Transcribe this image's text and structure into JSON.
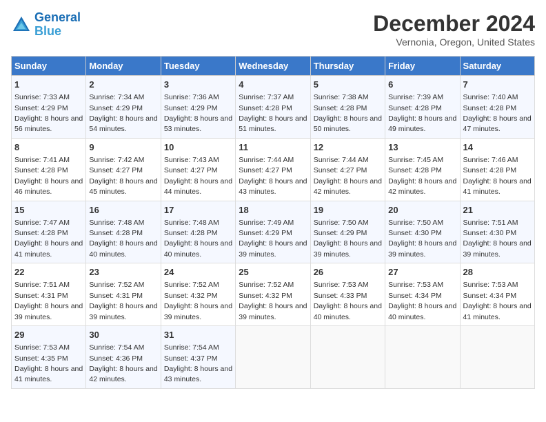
{
  "header": {
    "logo_line1": "General",
    "logo_line2": "Blue",
    "title": "December 2024",
    "subtitle": "Vernonia, Oregon, United States"
  },
  "calendar": {
    "days_of_week": [
      "Sunday",
      "Monday",
      "Tuesday",
      "Wednesday",
      "Thursday",
      "Friday",
      "Saturday"
    ],
    "weeks": [
      [
        {
          "day": "1",
          "sunrise": "7:33 AM",
          "sunset": "4:29 PM",
          "daylight": "8 hours and 56 minutes."
        },
        {
          "day": "2",
          "sunrise": "7:34 AM",
          "sunset": "4:29 PM",
          "daylight": "8 hours and 54 minutes."
        },
        {
          "day": "3",
          "sunrise": "7:36 AM",
          "sunset": "4:29 PM",
          "daylight": "8 hours and 53 minutes."
        },
        {
          "day": "4",
          "sunrise": "7:37 AM",
          "sunset": "4:28 PM",
          "daylight": "8 hours and 51 minutes."
        },
        {
          "day": "5",
          "sunrise": "7:38 AM",
          "sunset": "4:28 PM",
          "daylight": "8 hours and 50 minutes."
        },
        {
          "day": "6",
          "sunrise": "7:39 AM",
          "sunset": "4:28 PM",
          "daylight": "8 hours and 49 minutes."
        },
        {
          "day": "7",
          "sunrise": "7:40 AM",
          "sunset": "4:28 PM",
          "daylight": "8 hours and 47 minutes."
        }
      ],
      [
        {
          "day": "8",
          "sunrise": "7:41 AM",
          "sunset": "4:28 PM",
          "daylight": "8 hours and 46 minutes."
        },
        {
          "day": "9",
          "sunrise": "7:42 AM",
          "sunset": "4:27 PM",
          "daylight": "8 hours and 45 minutes."
        },
        {
          "day": "10",
          "sunrise": "7:43 AM",
          "sunset": "4:27 PM",
          "daylight": "8 hours and 44 minutes."
        },
        {
          "day": "11",
          "sunrise": "7:44 AM",
          "sunset": "4:27 PM",
          "daylight": "8 hours and 43 minutes."
        },
        {
          "day": "12",
          "sunrise": "7:44 AM",
          "sunset": "4:27 PM",
          "daylight": "8 hours and 42 minutes."
        },
        {
          "day": "13",
          "sunrise": "7:45 AM",
          "sunset": "4:28 PM",
          "daylight": "8 hours and 42 minutes."
        },
        {
          "day": "14",
          "sunrise": "7:46 AM",
          "sunset": "4:28 PM",
          "daylight": "8 hours and 41 minutes."
        }
      ],
      [
        {
          "day": "15",
          "sunrise": "7:47 AM",
          "sunset": "4:28 PM",
          "daylight": "8 hours and 41 minutes."
        },
        {
          "day": "16",
          "sunrise": "7:48 AM",
          "sunset": "4:28 PM",
          "daylight": "8 hours and 40 minutes."
        },
        {
          "day": "17",
          "sunrise": "7:48 AM",
          "sunset": "4:28 PM",
          "daylight": "8 hours and 40 minutes."
        },
        {
          "day": "18",
          "sunrise": "7:49 AM",
          "sunset": "4:29 PM",
          "daylight": "8 hours and 39 minutes."
        },
        {
          "day": "19",
          "sunrise": "7:50 AM",
          "sunset": "4:29 PM",
          "daylight": "8 hours and 39 minutes."
        },
        {
          "day": "20",
          "sunrise": "7:50 AM",
          "sunset": "4:30 PM",
          "daylight": "8 hours and 39 minutes."
        },
        {
          "day": "21",
          "sunrise": "7:51 AM",
          "sunset": "4:30 PM",
          "daylight": "8 hours and 39 minutes."
        }
      ],
      [
        {
          "day": "22",
          "sunrise": "7:51 AM",
          "sunset": "4:31 PM",
          "daylight": "8 hours and 39 minutes."
        },
        {
          "day": "23",
          "sunrise": "7:52 AM",
          "sunset": "4:31 PM",
          "daylight": "8 hours and 39 minutes."
        },
        {
          "day": "24",
          "sunrise": "7:52 AM",
          "sunset": "4:32 PM",
          "daylight": "8 hours and 39 minutes."
        },
        {
          "day": "25",
          "sunrise": "7:52 AM",
          "sunset": "4:32 PM",
          "daylight": "8 hours and 39 minutes."
        },
        {
          "day": "26",
          "sunrise": "7:53 AM",
          "sunset": "4:33 PM",
          "daylight": "8 hours and 40 minutes."
        },
        {
          "day": "27",
          "sunrise": "7:53 AM",
          "sunset": "4:34 PM",
          "daylight": "8 hours and 40 minutes."
        },
        {
          "day": "28",
          "sunrise": "7:53 AM",
          "sunset": "4:34 PM",
          "daylight": "8 hours and 41 minutes."
        }
      ],
      [
        {
          "day": "29",
          "sunrise": "7:53 AM",
          "sunset": "4:35 PM",
          "daylight": "8 hours and 41 minutes."
        },
        {
          "day": "30",
          "sunrise": "7:54 AM",
          "sunset": "4:36 PM",
          "daylight": "8 hours and 42 minutes."
        },
        {
          "day": "31",
          "sunrise": "7:54 AM",
          "sunset": "4:37 PM",
          "daylight": "8 hours and 43 minutes."
        },
        null,
        null,
        null,
        null
      ]
    ]
  },
  "labels": {
    "sunrise_label": "Sunrise:",
    "sunset_label": "Sunset:",
    "daylight_label": "Daylight:"
  }
}
